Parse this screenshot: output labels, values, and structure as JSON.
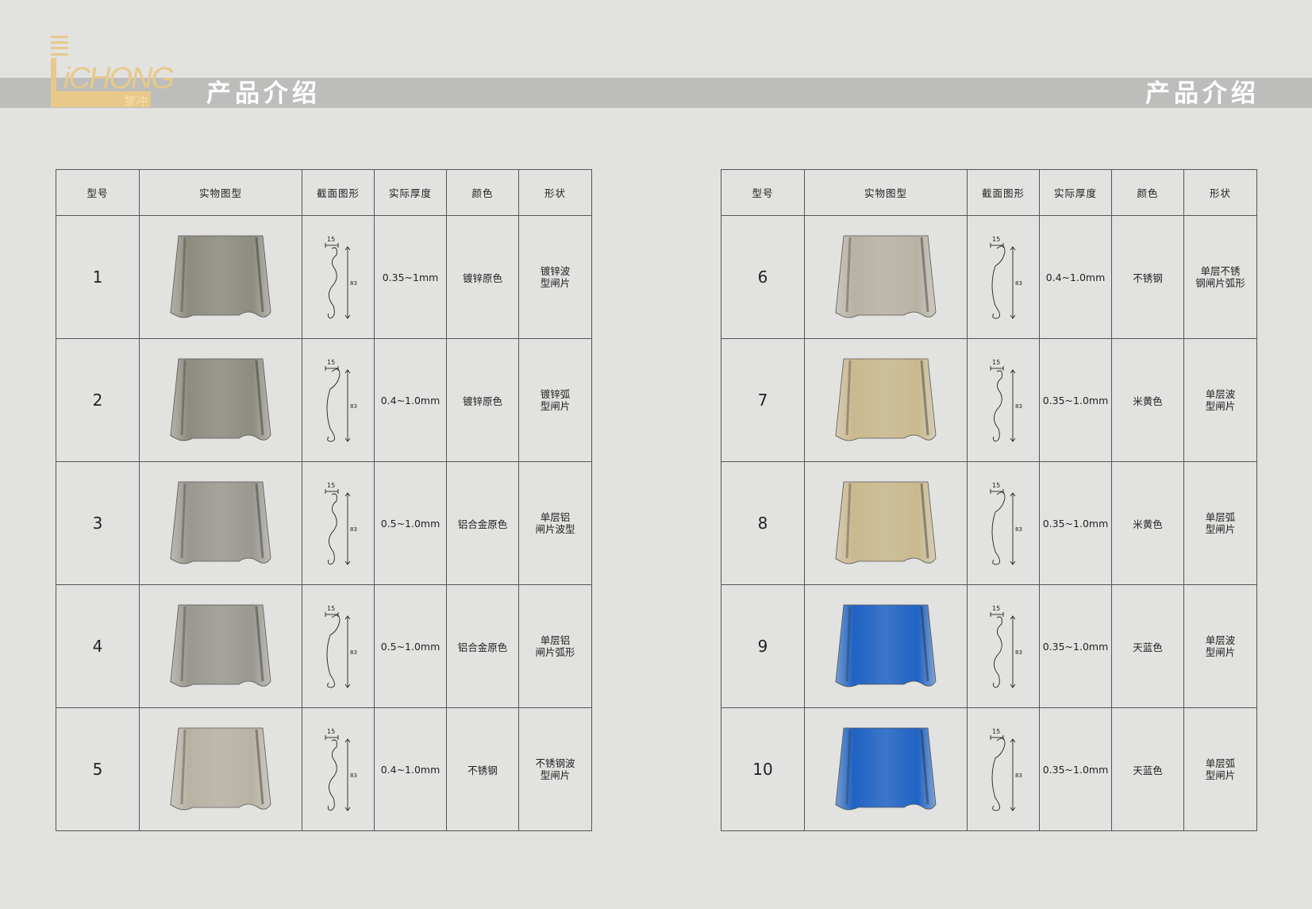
{
  "brand": {
    "logo_text": "LiCHONG",
    "logo_sub": "黎冲"
  },
  "header": {
    "title_left": "产品介绍",
    "title_right": "产品介绍"
  },
  "columns": [
    "型号",
    "实物图型",
    "截面图形",
    "实际厚度",
    "颜色",
    "形状"
  ],
  "dims": {
    "width": "15",
    "height": "83"
  },
  "colors": {
    "galvanized": "#8e8c80",
    "stainless": "#b8b2a4",
    "beige": "#c9b98e",
    "sky_blue": "#1f63c4",
    "aluminum": "#9a9890"
  },
  "products": [
    {
      "id": "1",
      "thickness": "0.35~1mm",
      "color": "镀锌原色",
      "shape": [
        "镀锌波",
        "型闸片"
      ],
      "swatch": "galvanized",
      "profile": "wave"
    },
    {
      "id": "2",
      "thickness": "0.4~1.0mm",
      "color": "镀锌原色",
      "shape": [
        "镀锌弧",
        "型闸片"
      ],
      "swatch": "galvanized",
      "profile": "arc"
    },
    {
      "id": "3",
      "thickness": "0.5~1.0mm",
      "color": "铝合金原色",
      "shape": [
        "单层铝",
        "闸片波型"
      ],
      "swatch": "aluminum",
      "profile": "wave"
    },
    {
      "id": "4",
      "thickness": "0.5~1.0mm",
      "color": "铝合金原色",
      "shape": [
        "单层铝",
        "闸片弧形"
      ],
      "swatch": "aluminum",
      "profile": "arc"
    },
    {
      "id": "5",
      "thickness": "0.4~1.0mm",
      "color": "不锈钢",
      "shape": [
        "不锈钢波",
        "型闸片"
      ],
      "swatch": "stainless",
      "profile": "wave"
    },
    {
      "id": "6",
      "thickness": "0.4~1.0mm",
      "color": "不锈钢",
      "shape": [
        "单层不锈",
        "钢闸片弧形"
      ],
      "swatch": "stainless",
      "profile": "arc"
    },
    {
      "id": "7",
      "thickness": "0.35~1.0mm",
      "color": "米黄色",
      "shape": [
        "单层波",
        "型闸片"
      ],
      "swatch": "beige",
      "profile": "wave"
    },
    {
      "id": "8",
      "thickness": "0.35~1.0mm",
      "color": "米黄色",
      "shape": [
        "单层弧",
        "型闸片"
      ],
      "swatch": "beige",
      "profile": "arc"
    },
    {
      "id": "9",
      "thickness": "0.35~1.0mm",
      "color": "天蓝色",
      "shape": [
        "单层波",
        "型闸片"
      ],
      "swatch": "sky_blue",
      "profile": "wave"
    },
    {
      "id": "10",
      "thickness": "0.35~1.0mm",
      "color": "天蓝色",
      "shape": [
        "单层弧",
        "型闸片"
      ],
      "swatch": "sky_blue",
      "profile": "arc"
    }
  ]
}
